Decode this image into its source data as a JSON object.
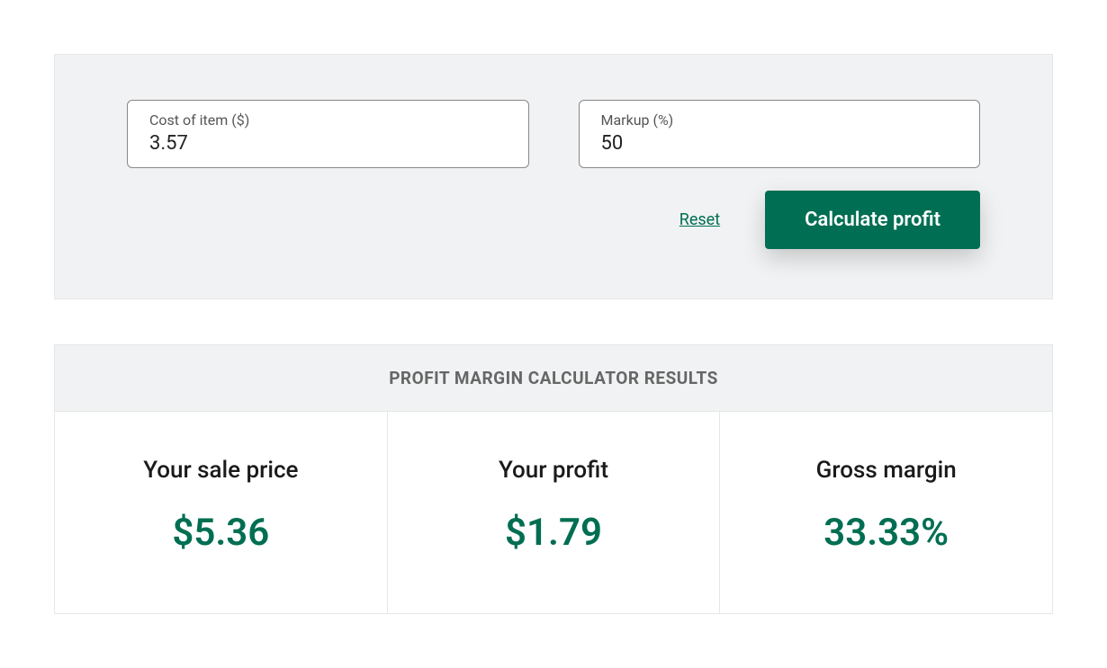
{
  "form": {
    "cost_label": "Cost of item ($)",
    "cost_value": "3.57",
    "markup_label": "Markup (%)",
    "markup_value": "50",
    "reset_label": "Reset",
    "calculate_label": "Calculate profit"
  },
  "results": {
    "header": "PROFIT MARGIN CALCULATOR RESULTS",
    "sale_price_label": "Your sale price",
    "sale_price_value": "$5.36",
    "profit_label": "Your profit",
    "profit_value": "$1.79",
    "gross_margin_label": "Gross margin",
    "gross_margin_value": "33.33%"
  }
}
